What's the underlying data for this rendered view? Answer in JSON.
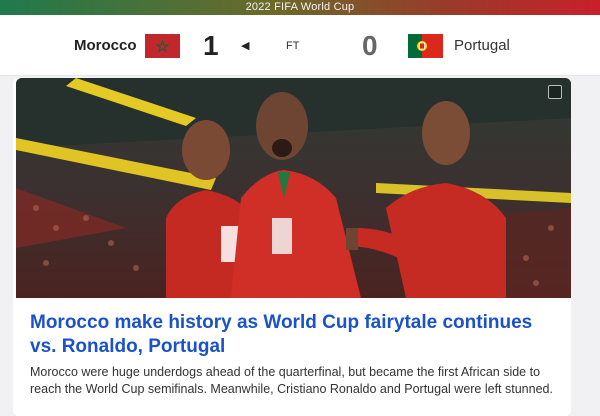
{
  "header": {
    "tournament": "2022 FIFA World Cup"
  },
  "match": {
    "home_team": "Morocco",
    "home_score": "1",
    "status": "FT",
    "away_team": "Portugal",
    "away_score": "0"
  },
  "article": {
    "headline": "Morocco make history as World Cup fairytale continues vs. Ronaldo, Portugal",
    "summary": "Morocco were huge underdogs ahead of the quarterfinal, but became the first African side to reach the World Cup semifinals. Meanwhile, Cristiano Ronaldo and Portugal were left stunned."
  },
  "colors": {
    "headline": "#1a53c9",
    "morocco_red": "#c1272d",
    "portugal_green": "#046a38"
  },
  "icons": [
    "morocco-flag-icon",
    "portugal-flag-icon",
    "winner-arrow-icon",
    "expand-icon"
  ]
}
